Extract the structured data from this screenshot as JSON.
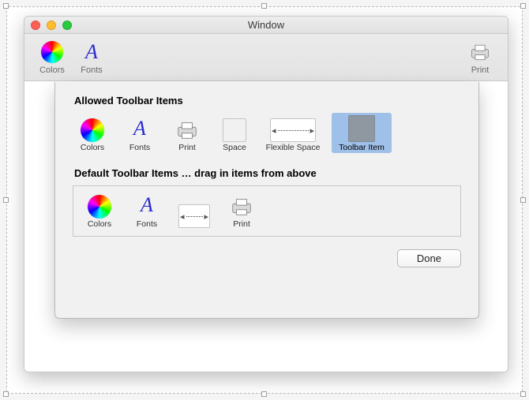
{
  "window": {
    "title": "Window"
  },
  "toolbar": {
    "items": [
      {
        "name": "colors",
        "label": "Colors"
      },
      {
        "name": "fonts",
        "label": "Fonts"
      },
      {
        "name": "print",
        "label": "Print"
      }
    ]
  },
  "sheet": {
    "allowed_header": "Allowed Toolbar Items",
    "default_header": "Default Toolbar Items … drag in items from above",
    "done_label": "Done",
    "allowed_items": [
      {
        "name": "colors",
        "label": "Colors"
      },
      {
        "name": "fonts",
        "label": "Fonts"
      },
      {
        "name": "print",
        "label": "Print"
      },
      {
        "name": "space",
        "label": "Space"
      },
      {
        "name": "flexible-space",
        "label": "Flexible Space"
      },
      {
        "name": "toolbar-item",
        "label": "Toolbar Item",
        "selected": true
      }
    ],
    "default_items": [
      {
        "name": "colors",
        "label": "Colors"
      },
      {
        "name": "fonts",
        "label": "Fonts"
      },
      {
        "name": "flexible-space",
        "label": ""
      },
      {
        "name": "print",
        "label": "Print"
      }
    ]
  }
}
